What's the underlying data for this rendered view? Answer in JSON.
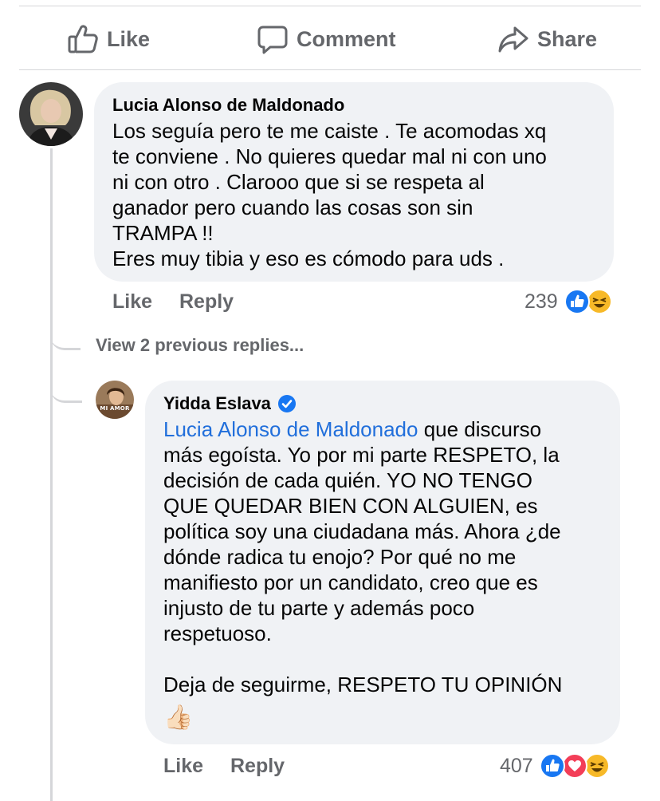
{
  "actions": {
    "like_label": "Like",
    "comment_label": "Comment",
    "share_label": "Share"
  },
  "comments": [
    {
      "author": "Lucia Alonso de Maldonado",
      "text": "Los seguía pero te me caiste . Te acomodas xq\nte conviene . No quieres quedar mal ni con uno\nni con otro . Clarooo que si se respeta al\nganador pero cuando las cosas son sin\nTRAMPA !!\nEres muy tibia y eso es cómodo para uds .",
      "like_label": "Like",
      "reply_label": "Reply",
      "reaction_count": "239",
      "reactions": [
        "like-reaction-icon",
        "haha-reaction-icon"
      ]
    }
  ],
  "view_previous_replies": "View 2 previous replies...",
  "reply": {
    "author": "Yidda Eslava",
    "verified_icon": "verified-badge-icon",
    "mention": "Lucia Alonso de Maldonado",
    "text_after_mention": " que discurso\nmás egoísta. Yo por mi parte RESPETO, la\ndecisión de cada quién. YO NO TENGO\nQUE QUEDAR BIEN CON ALGUIEN, es\npolítica soy una ciudadana más. Ahora ¿de\ndónde radica tu enojo? Por qué no me\nmanifiesto por un candidato, creo que es\ninjusto de tu parte y además poco\nrespetuoso.\n\nDeja de seguirme, RESPETO TU OPINIÓN",
    "trailing_emoji": "👍🏻",
    "avatar_text": "MI AMOR",
    "like_label": "Like",
    "reply_label": "Reply",
    "reaction_count": "407",
    "reactions": [
      "like-reaction-icon",
      "love-reaction-icon",
      "haha-reaction-icon"
    ]
  },
  "colors": {
    "like_blue": "#1877f2",
    "love_red": "#f33e58",
    "haha_yellow": "#f7b928",
    "mention_blue": "#216fdb",
    "bubble_bg": "#f0f2f5",
    "meta_gray": "#65676b"
  }
}
